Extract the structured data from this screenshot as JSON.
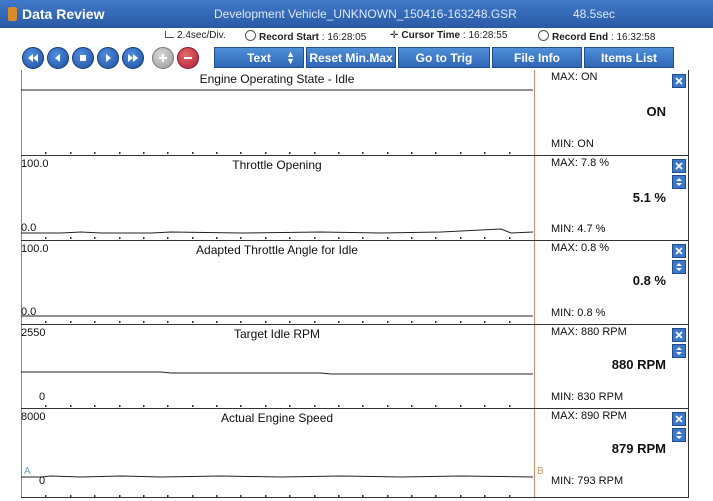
{
  "titlebar": {
    "app_title": "Data Review",
    "file_title": "Development Vehicle_UNKNOWN_150416-163248.GSR",
    "duration": "48.5sec"
  },
  "info": {
    "division": "2.4sec/Div.",
    "record_start_label": "Record Start",
    "record_start_value": ": 16:28:05",
    "cursor_time_label": "Cursor Time",
    "cursor_time_value": ": 16:28:55",
    "record_end_label": "Record End",
    "record_end_value": ": 16:32:58"
  },
  "toolbar": {
    "icons": [
      "rewind-icon",
      "previous-icon",
      "stop-icon",
      "play-icon",
      "fast-forward-icon",
      "zoom-in-icon",
      "zoom-out-icon"
    ],
    "text_label": "Text",
    "reset_label": "Reset Min.Max",
    "goto_label": "Go to Trig",
    "fileinfo_label": "File Info",
    "itemslist_label": "Items List",
    "accent": "#2f66b6"
  },
  "panels": [
    {
      "title": "Engine Operating State - Idle",
      "ymax": "",
      "ymin": "",
      "max": "MAX: ON",
      "min": "MIN: ON",
      "value": "ON",
      "has_scale": false
    },
    {
      "title": "Throttle Opening",
      "ymax": "100.0",
      "ymin": "0.0",
      "max": "MAX:  7.8 %",
      "min": "MIN:  4.7 %",
      "value": "5.1 %",
      "has_scale": true
    },
    {
      "title": "Adapted Throttle Angle for Idle",
      "ymax": "100.0",
      "ymin": "0.0",
      "max": "MAX:  0.8 %",
      "min": "MIN:  0.8 %",
      "value": "0.8 %",
      "has_scale": true
    },
    {
      "title": "Target Idle RPM",
      "ymax": "2550",
      "ymin": "0",
      "max": "MAX:  880 RPM",
      "min": "MIN:  830 RPM",
      "value": "880 RPM",
      "has_scale": true
    },
    {
      "title": "Actual Engine Speed",
      "ymax": "8000",
      "ymin": "0",
      "max": "MAX:  890 RPM",
      "min": "MIN:  793 RPM",
      "value": "879 RPM",
      "has_scale": true
    }
  ],
  "cursor_labels": {
    "a": "A",
    "b": "B"
  }
}
